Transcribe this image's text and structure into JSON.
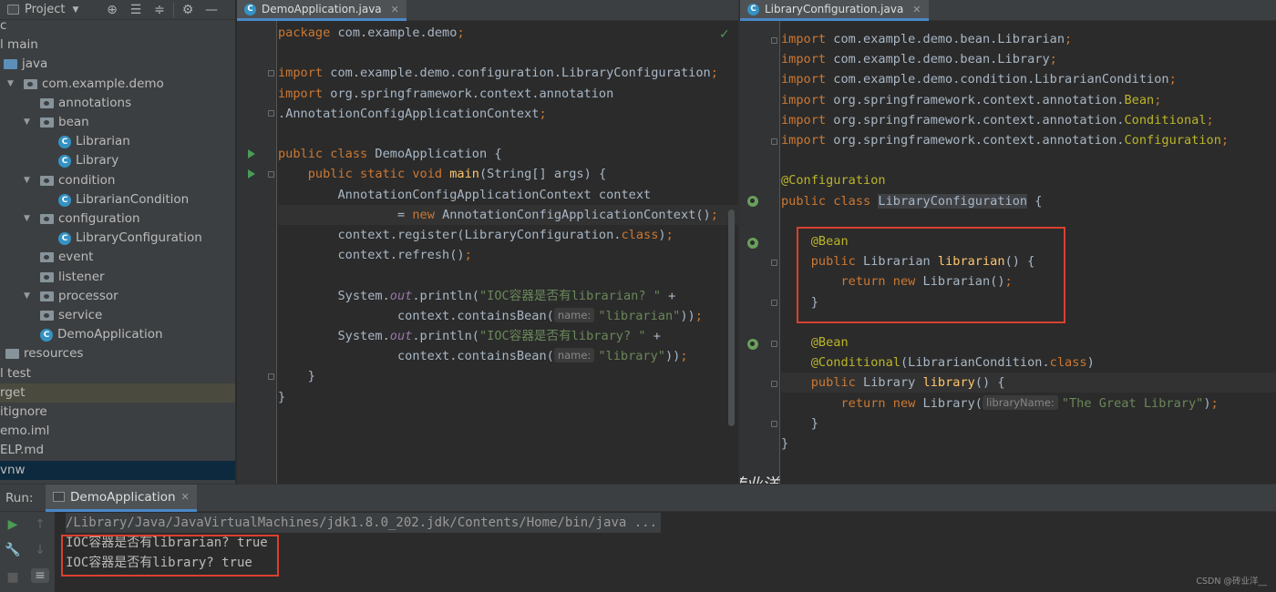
{
  "project": {
    "title": "Project",
    "tree": [
      {
        "label": "c",
        "x": 0,
        "icon": "none"
      },
      {
        "label": "l main",
        "x": 0,
        "icon": "none"
      },
      {
        "label": "java",
        "x": 4,
        "icon": "folder-blue",
        "arrow": false
      },
      {
        "label": "com.example.demo",
        "x": 26,
        "icon": "package",
        "arrow": true
      },
      {
        "label": "annotations",
        "x": 44,
        "icon": "package",
        "arrow": false
      },
      {
        "label": "bean",
        "x": 44,
        "icon": "package",
        "arrow": true
      },
      {
        "label": "Librarian",
        "x": 64,
        "icon": "class",
        "arrow": false
      },
      {
        "label": "Library",
        "x": 64,
        "icon": "class",
        "arrow": false
      },
      {
        "label": "condition",
        "x": 44,
        "icon": "package",
        "arrow": true
      },
      {
        "label": "LibrarianCondition",
        "x": 64,
        "icon": "class",
        "arrow": false
      },
      {
        "label": "configuration",
        "x": 44,
        "icon": "package",
        "arrow": true
      },
      {
        "label": "LibraryConfiguration",
        "x": 64,
        "icon": "class",
        "arrow": false
      },
      {
        "label": "event",
        "x": 44,
        "icon": "package",
        "arrow": false
      },
      {
        "label": "listener",
        "x": 44,
        "icon": "package",
        "arrow": false
      },
      {
        "label": "processor",
        "x": 44,
        "icon": "package",
        "arrow": true
      },
      {
        "label": "service",
        "x": 44,
        "icon": "package",
        "arrow": false
      },
      {
        "label": "DemoApplication",
        "x": 44,
        "icon": "class",
        "arrow": false
      },
      {
        "label": "resources",
        "x": 6,
        "icon": "folder",
        "arrow": false
      },
      {
        "label": "l test",
        "x": 0,
        "icon": "none"
      },
      {
        "label": "rget",
        "x": 0,
        "icon": "none",
        "state": "hl"
      },
      {
        "label": "itignore",
        "x": 0,
        "icon": "none"
      },
      {
        "label": "emo.iml",
        "x": 0,
        "icon": "none"
      },
      {
        "label": "ELP.md",
        "x": 0,
        "icon": "none"
      },
      {
        "label": "vnw",
        "x": 0,
        "icon": "none",
        "state": "sel"
      }
    ]
  },
  "left_editor": {
    "tab": "DemoApplication.java",
    "lines": [
      [
        [
          "kw",
          "package "
        ],
        [
          "",
          "com.example.demo"
        ],
        [
          "kw",
          ";"
        ]
      ],
      [],
      [
        [
          "kw",
          "import "
        ],
        [
          "",
          "com.example.demo.configuration.LibraryConfiguration"
        ],
        [
          "kw",
          ";"
        ]
      ],
      [
        [
          "kw",
          "import "
        ],
        [
          "",
          "org.springframework.context.annotation"
        ]
      ],
      [
        [
          "",
          "."
        ],
        [
          "",
          "AnnotationConfigApplicationContext"
        ],
        [
          "kw",
          ";"
        ]
      ],
      [],
      [
        [
          "kw",
          "public class "
        ],
        [
          "",
          "DemoApplication {"
        ]
      ],
      [
        [
          "",
          "    "
        ],
        [
          "kw",
          "public static void "
        ],
        [
          "fn",
          "main"
        ],
        [
          "",
          "(String[] args) {"
        ]
      ],
      [
        [
          "",
          "        AnnotationConfigApplicationContext context"
        ]
      ],
      [
        [
          "",
          "                = "
        ],
        [
          "kw",
          "new "
        ],
        [
          "",
          "AnnotationConfigApplicationContext()"
        ],
        [
          "kw",
          ";"
        ]
      ],
      [
        [
          "",
          "        context.register(LibraryConfiguration."
        ],
        [
          "kw",
          "class"
        ],
        [
          "",
          ")"
        ],
        [
          "kw",
          ";"
        ]
      ],
      [
        [
          "",
          "        context.refresh()"
        ],
        [
          "kw",
          ";"
        ]
      ],
      [],
      [
        [
          "",
          "        System."
        ],
        [
          "it",
          "out"
        ],
        [
          "",
          ".println("
        ],
        [
          "str",
          "\"IOC容器是否有librarian? \" "
        ],
        [
          "",
          "+"
        ]
      ],
      [
        [
          "",
          "                context.containsBean("
        ],
        [
          "hint",
          "name:"
        ],
        [
          "str",
          "\"librarian\""
        ],
        [
          "",
          "))"
        ],
        [
          "kw",
          ";"
        ]
      ],
      [
        [
          "",
          "        System."
        ],
        [
          "it",
          "out"
        ],
        [
          "",
          ".println("
        ],
        [
          "str",
          "\"IOC容器是否有library? \" "
        ],
        [
          "",
          "+"
        ]
      ],
      [
        [
          "",
          "                context.containsBean("
        ],
        [
          "hint",
          "name:"
        ],
        [
          "str",
          "\"library\""
        ],
        [
          "",
          "))"
        ],
        [
          "kw",
          ";"
        ]
      ],
      [
        [
          "",
          "    }"
        ]
      ],
      [
        [
          "",
          "}"
        ]
      ]
    ]
  },
  "right_editor": {
    "tab": "LibraryConfiguration.java",
    "lines": [
      [
        [
          "kw",
          "import "
        ],
        [
          "",
          "com.example.demo.bean.Librarian"
        ],
        [
          "kw",
          ";"
        ]
      ],
      [
        [
          "kw",
          "import "
        ],
        [
          "",
          "com.example.demo.bean.Library"
        ],
        [
          "kw",
          ";"
        ]
      ],
      [
        [
          "kw",
          "import "
        ],
        [
          "",
          "com.example.demo.condition.LibrarianCondition"
        ],
        [
          "kw",
          ";"
        ]
      ],
      [
        [
          "kw",
          "import "
        ],
        [
          "",
          "org.springframework.context.annotation."
        ],
        [
          "an",
          "Bean"
        ],
        [
          "kw",
          ";"
        ]
      ],
      [
        [
          "kw",
          "import "
        ],
        [
          "",
          "org.springframework.context.annotation."
        ],
        [
          "an",
          "Conditional"
        ],
        [
          "kw",
          ";"
        ]
      ],
      [
        [
          "kw",
          "import "
        ],
        [
          "",
          "org.springframework.context.annotation."
        ],
        [
          "an",
          "Configuration"
        ],
        [
          "kw",
          ";"
        ]
      ],
      [],
      [
        [
          "an",
          "@Configuration"
        ]
      ],
      [
        [
          "kw",
          "public class "
        ],
        [
          "hlbg",
          "LibraryConfiguration"
        ],
        [
          "",
          " {"
        ]
      ],
      [],
      [
        [
          "",
          "    "
        ],
        [
          "an",
          "@Bean"
        ]
      ],
      [
        [
          "",
          "    "
        ],
        [
          "kw",
          "public "
        ],
        [
          "",
          "Librarian "
        ],
        [
          "fn",
          "librarian"
        ],
        [
          "",
          "() {"
        ]
      ],
      [
        [
          "",
          "        "
        ],
        [
          "kw",
          "return new "
        ],
        [
          "",
          "Librarian()"
        ],
        [
          "kw",
          ";"
        ]
      ],
      [
        [
          "",
          "    }"
        ]
      ],
      [],
      [
        [
          "",
          "    "
        ],
        [
          "an",
          "@Bean"
        ]
      ],
      [
        [
          "",
          "    "
        ],
        [
          "an",
          "@Conditional"
        ],
        [
          "",
          "(LibrarianCondition."
        ],
        [
          "kw",
          "class"
        ],
        [
          "",
          ")"
        ]
      ],
      [
        [
          "",
          "    "
        ],
        [
          "kw",
          "public "
        ],
        [
          "",
          "Library "
        ],
        [
          "fn",
          "library"
        ],
        [
          "",
          "() {"
        ]
      ],
      [
        [
          "",
          "        "
        ],
        [
          "kw",
          "return new "
        ],
        [
          "",
          "Library("
        ],
        [
          "hint",
          "libraryName:"
        ],
        [
          "str",
          "\"The Great Library\""
        ],
        [
          "",
          ")"
        ],
        [
          "kw",
          ";"
        ]
      ],
      [
        [
          "",
          "    }"
        ]
      ],
      [
        [
          "",
          "}"
        ]
      ]
    ]
  },
  "watermark": "@砖业洋__",
  "run": {
    "label": "Run:",
    "tab": "DemoApplication",
    "output": [
      "/Library/Java/JavaVirtualMachines/jdk1.8.0_202.jdk/Contents/Home/bin/java ...",
      "IOC容器是否有librarian? true",
      "IOC容器是否有library? true"
    ]
  },
  "csdn_credit": "CSDN @砖业洋__",
  "colors": {
    "background": "#2b2b2b",
    "panel": "#3c3f41",
    "keyword": "#cc7832",
    "annotation": "#bbb529",
    "string": "#6a8759",
    "method": "#ffc66d",
    "highlight_box": "#d9412f",
    "run_green": "#499c54"
  }
}
